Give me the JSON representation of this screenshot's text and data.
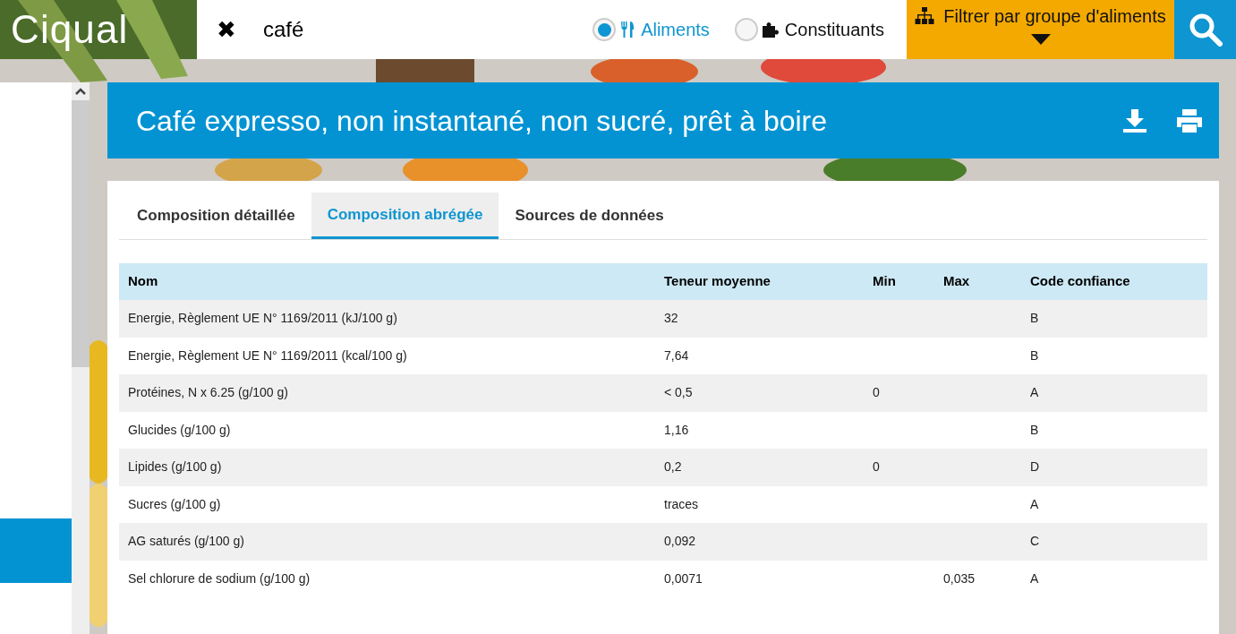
{
  "header": {
    "logo": "Ciqual",
    "clear_icon": "✖",
    "search_value": "café",
    "search_types": [
      {
        "label": "Aliments",
        "selected": true
      },
      {
        "label": "Constituants",
        "selected": false
      }
    ],
    "filter_button": "Filtrer par groupe d'aliments"
  },
  "food": {
    "title": "Café expresso, non instantané, non sucré, prêt à boire"
  },
  "tabs": [
    {
      "label": "Composition détaillée",
      "selected": false
    },
    {
      "label": "Composition abrégée",
      "selected": true
    },
    {
      "label": "Sources de données",
      "selected": false
    }
  ],
  "table": {
    "columns": [
      "Nom",
      "Teneur moyenne",
      "Min",
      "Max",
      "Code confiance"
    ],
    "rows": [
      [
        "Energie, Règlement UE N° 1169/2011 (kJ/100 g)",
        "32",
        "",
        "",
        "B"
      ],
      [
        "Energie, Règlement UE N° 1169/2011 (kcal/100 g)",
        "7,64",
        "",
        "",
        "B"
      ],
      [
        "Protéines, N x 6.25 (g/100 g)",
        "< 0,5",
        "0",
        "",
        "A"
      ],
      [
        "Glucides (g/100 g)",
        "1,16",
        "",
        "",
        "B"
      ],
      [
        "Lipides (g/100 g)",
        "0,2",
        "0",
        "",
        "D"
      ],
      [
        "Sucres (g/100 g)",
        "traces",
        "",
        "",
        "A"
      ],
      [
        "AG saturés (g/100 g)",
        "0,092",
        "",
        "",
        "C"
      ],
      [
        "Sel chlorure de sodium (g/100 g)",
        "0,0071",
        "",
        "0,035",
        "A"
      ]
    ]
  }
}
